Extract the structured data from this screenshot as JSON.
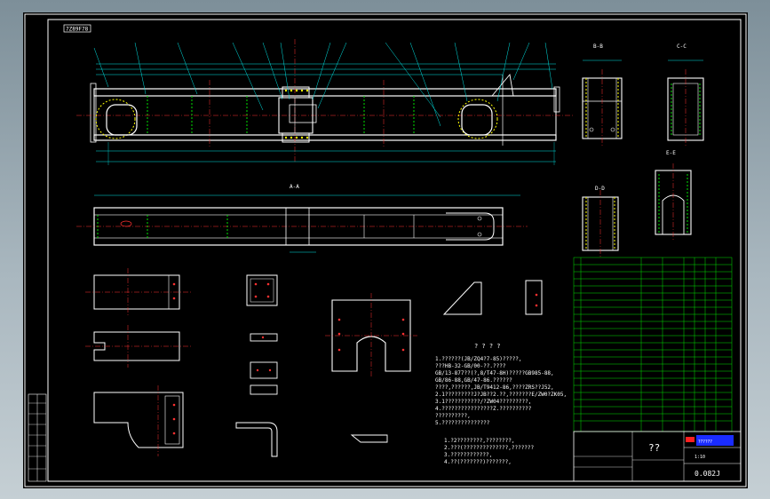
{
  "drawing": {
    "drawing_no_box": "7Z89F78",
    "section_aa_label": "A-A",
    "view_bb_label": "B-B",
    "view_cc_label": "C-C",
    "view_dd_label": "D-D",
    "view_ee_label": "E-E",
    "tech_title": "? ? ? ?",
    "tech_notes": [
      "1.??????(JB/ZQ4?7-85)?????,",
      "  ???HB-32-GB/00-??.????",
      "  GB/13-877??(?,8/T47-8H)?????GB985-88,",
      "  GB/86-88,GB/47-86.??????",
      "  ????,??????,JB/T9412-86,????ZRS??J52,",
      "2.1?????????J?JB??2.??,???????E/ZW0?ZK05,",
      "3.1???????????/?ZW04?????????,",
      "4.????????????????Z.??????????",
      "  ??????????,",
      "5.???????????????"
    ],
    "tech_notes_2": [
      "1.?2????????,????????,",
      "2.???(??????????????,???????",
      "3.????????????,",
      "4.??(???????)???????,"
    ],
    "title_block": {
      "name": "??",
      "company": "??????",
      "code": "0.082J",
      "scale_label": "1:10"
    }
  }
}
